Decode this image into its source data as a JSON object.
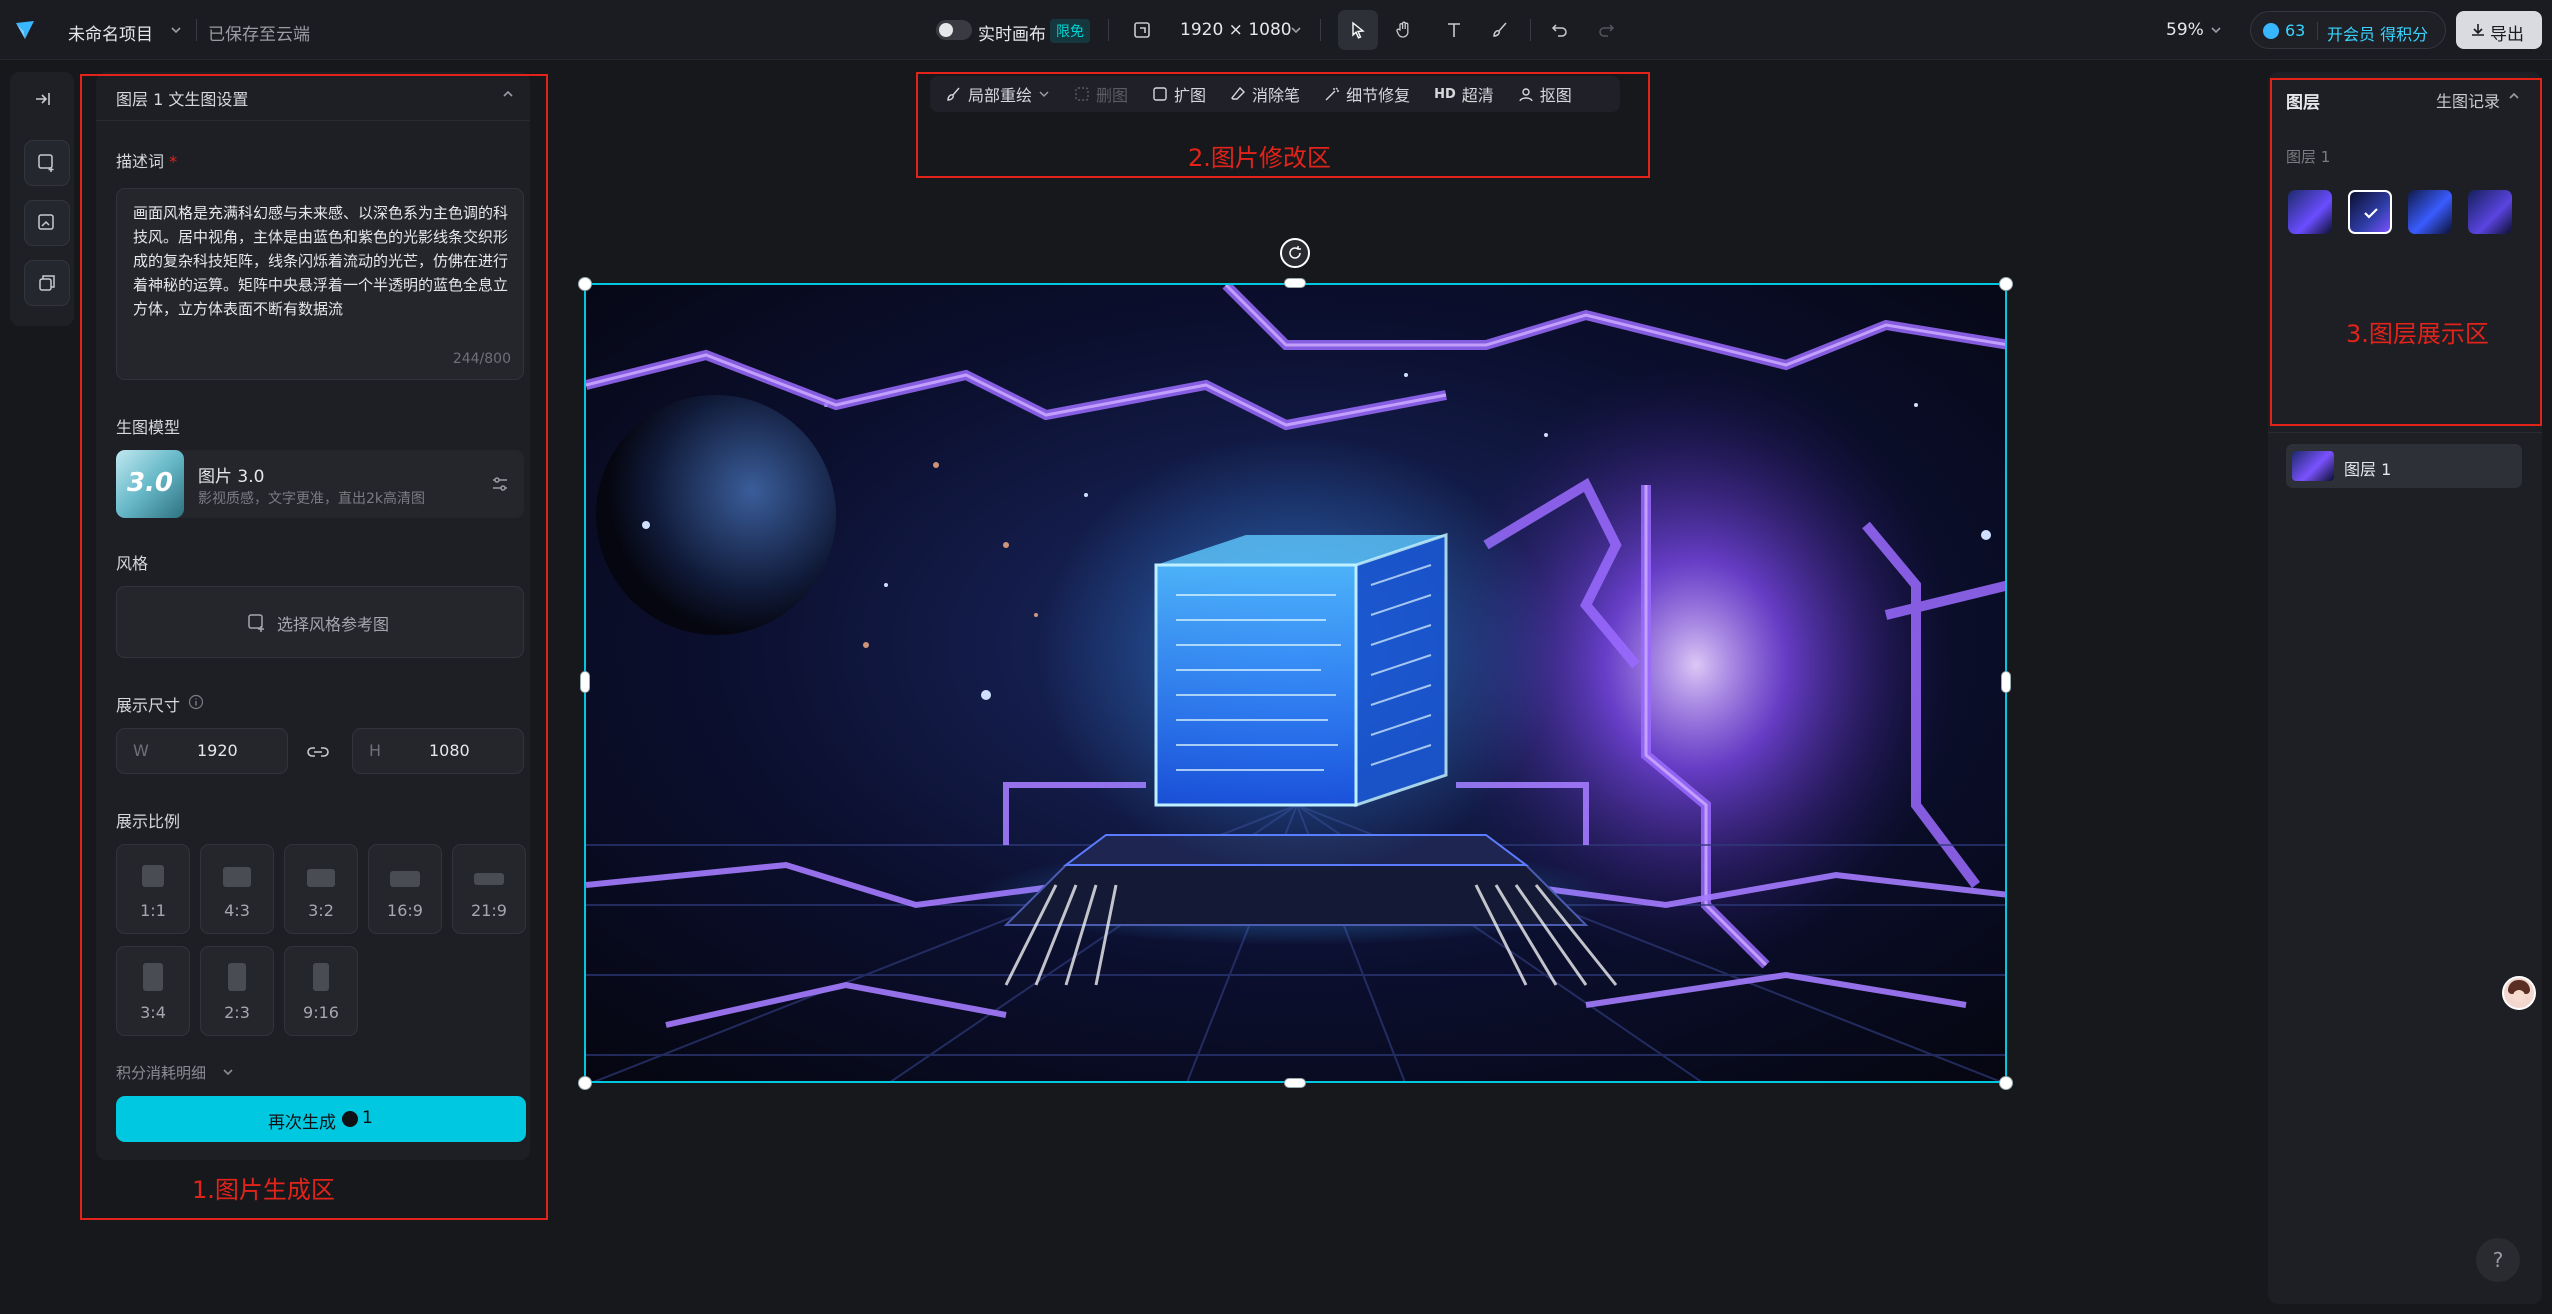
{
  "topbar": {
    "project_name": "未命名项目",
    "save_status": "已保存至云端",
    "realtime_label": "实时画布",
    "realtime_badge": "限免",
    "canvas_size": "1920 × 1080",
    "zoom": "59%",
    "credits": "63",
    "member_label": "开会员 得积分",
    "export_label": "导出"
  },
  "left_panel": {
    "title": "图层 1 文生图设置",
    "prompt_label": "描述词",
    "prompt_required": "*",
    "prompt_text": "画面风格是充满科幻感与未来感、以深色系为主色调的科技风。居中视角，主体是由蓝色和紫色的光影线条交织形成的复杂科技矩阵，线条闪烁着流动的光芒，仿佛在进行着神秘的运算。矩阵中央悬浮着一个半透明的蓝色全息立方体，立方体表面不断有数据流",
    "prompt_count": "244/800",
    "model_label": "生图模型",
    "model_thumb_text": "3.0",
    "model_name": "图片 3.0",
    "model_desc": "影视质感，文字更准，直出2k高清图",
    "style_label": "风格",
    "style_button": "选择风格参考图",
    "size_label": "展示尺寸",
    "width_prefix": "W",
    "width_value": "1920",
    "height_prefix": "H",
    "height_value": "1080",
    "ratio_label": "展示比例",
    "ratios": [
      "1:1",
      "4:3",
      "3:2",
      "16:9",
      "21:9",
      "3:4",
      "2:3",
      "9:16"
    ],
    "cost_detail": "积分消耗明细",
    "regenerate_label": "再次生成",
    "regenerate_cost": "1"
  },
  "canvas_toolbar": {
    "items": [
      "局部重绘",
      "删图",
      "扩图",
      "消除笔",
      "细节修复",
      "超清",
      "抠图"
    ],
    "hd_badge": "HD"
  },
  "right_panel": {
    "title": "图层",
    "history_label": "生图记录",
    "group_label": "图层 1",
    "layer_item": "图层 1"
  },
  "annotations": {
    "left": "1.图片生成区",
    "center": "2.图片修改区",
    "right": "3.图层展示区"
  },
  "help_label": "?",
  "colors": {
    "accent": "#00c8e0",
    "annotation_red": "#e2231a",
    "background": "#17181c"
  }
}
